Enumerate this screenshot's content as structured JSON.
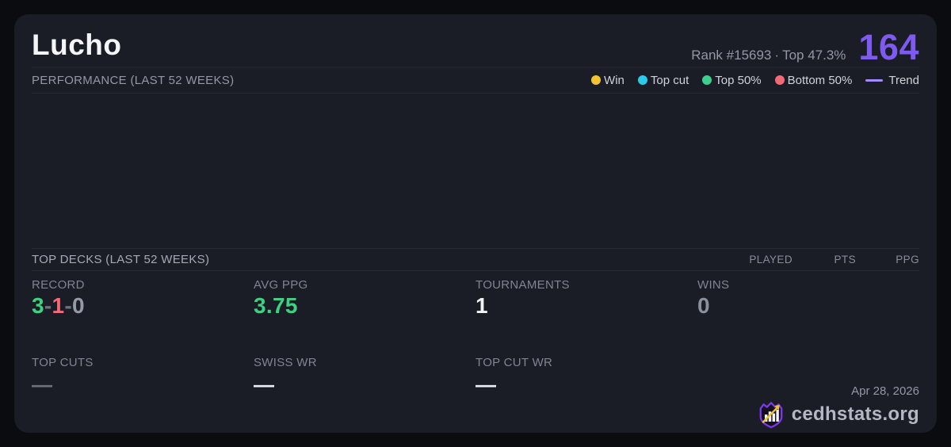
{
  "header": {
    "title": "Lucho",
    "rank_text": "Rank #15693",
    "rank_separator": "·",
    "top_percent_text": "Top 47.3%",
    "score": "164"
  },
  "performance": {
    "title": "PERFORMANCE (LAST 52 WEEKS)",
    "legend": [
      {
        "label": "Win",
        "color": "#f2c335",
        "swatch": "dot"
      },
      {
        "label": "Top cut",
        "color": "#2cc9e8",
        "swatch": "dot"
      },
      {
        "label": "Top 50%",
        "color": "#3ecf8e",
        "swatch": "dot"
      },
      {
        "label": "Bottom 50%",
        "color": "#f26a75",
        "swatch": "dot"
      },
      {
        "label": "Trend",
        "color": "#a78bfa",
        "swatch": "line"
      }
    ],
    "chart": {
      "type": "scatter",
      "points": [],
      "note": "chart area is empty - no data points rendered"
    }
  },
  "top_decks": {
    "title": "TOP DECKS (LAST 52 WEEKS)",
    "columns": [
      "PLAYED",
      "PTS",
      "PPG"
    ],
    "rows": []
  },
  "stats": {
    "record": {
      "label": "RECORD",
      "parts": [
        "3",
        "-",
        "1",
        "-",
        "0"
      ]
    },
    "avg_ppg": {
      "label": "AVG PPG",
      "value": "3.75"
    },
    "tournaments": {
      "label": "TOURNAMENTS",
      "value": "1"
    },
    "wins": {
      "label": "WINS",
      "value": "0"
    },
    "top_cuts": {
      "label": "TOP CUTS",
      "value": "—"
    },
    "swiss_wr": {
      "label": "SWISS WR",
      "value": "—"
    },
    "top_cut_wr": {
      "label": "TOP CUT WR",
      "value": "—"
    }
  },
  "footer": {
    "date": "Apr 28, 2026",
    "brand": "cedhstats.org"
  },
  "colors": {
    "card_background": "#1a1d26",
    "page_background": "#0b0c10",
    "accent_purple": "#7f5af0",
    "win_yellow": "#f2c335",
    "top_cut_cyan": "#2cc9e8",
    "top50_green": "#3ecf8e",
    "bottom50_red": "#f26a75",
    "trend_purple": "#a78bfa",
    "value_green": "#3fd180",
    "value_red": "#f26a75"
  }
}
